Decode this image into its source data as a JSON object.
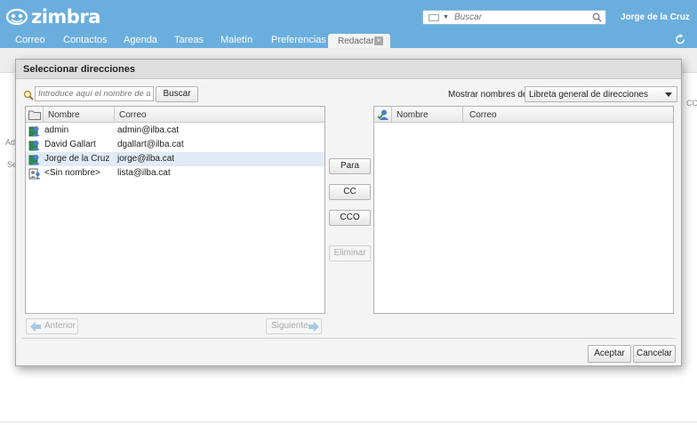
{
  "app": {
    "brand": "zimbra",
    "user": "Jorge de la Cruz",
    "search_placeholder": "Buscar"
  },
  "tabs": [
    {
      "label": "Correo"
    },
    {
      "label": "Contactos"
    },
    {
      "label": "Agenda"
    },
    {
      "label": "Tareas"
    },
    {
      "label": "Maletín"
    },
    {
      "label": "Preferencias"
    }
  ],
  "compose_tab": {
    "label": "Redactar",
    "close": "×"
  },
  "background": {
    "stub_ad": "Ad",
    "stub_se": "Se",
    "stub_co": "CO"
  },
  "dialog": {
    "title": "Seleccionar direcciones",
    "search_placeholder": "Introduce aquí el nombre de desti",
    "search_button": "Buscar",
    "show_names_label": "Mostrar nombres de:",
    "show_names_value": "Libreta general de direcciones",
    "columns": {
      "name": "Nombre",
      "email": "Correo"
    },
    "contacts": [
      {
        "name": "admin",
        "email": "admin@ilba.cat",
        "selected": false,
        "type": "contact"
      },
      {
        "name": "David Gallart",
        "email": "dgallart@ilba.cat",
        "selected": false,
        "type": "contact"
      },
      {
        "name": "Jorge de la Cruz",
        "email": "jorge@ilba.cat",
        "selected": true,
        "type": "contact"
      },
      {
        "name": "<Sin nombre>",
        "email": "lista@ilba.cat",
        "selected": false,
        "type": "group"
      }
    ],
    "buttons": {
      "to": "Para",
      "cc": "CC",
      "bcc": "CCO",
      "remove": "Eliminar"
    },
    "pager": {
      "prev": "Anterior",
      "next": "Siguiente"
    },
    "footer": {
      "ok": "Aceptar",
      "cancel": "Cancelar"
    }
  },
  "colors": {
    "accent": "#6aaedd",
    "selected_row": "#e0ebf5",
    "dialog_bg": "#f4f4f4"
  }
}
